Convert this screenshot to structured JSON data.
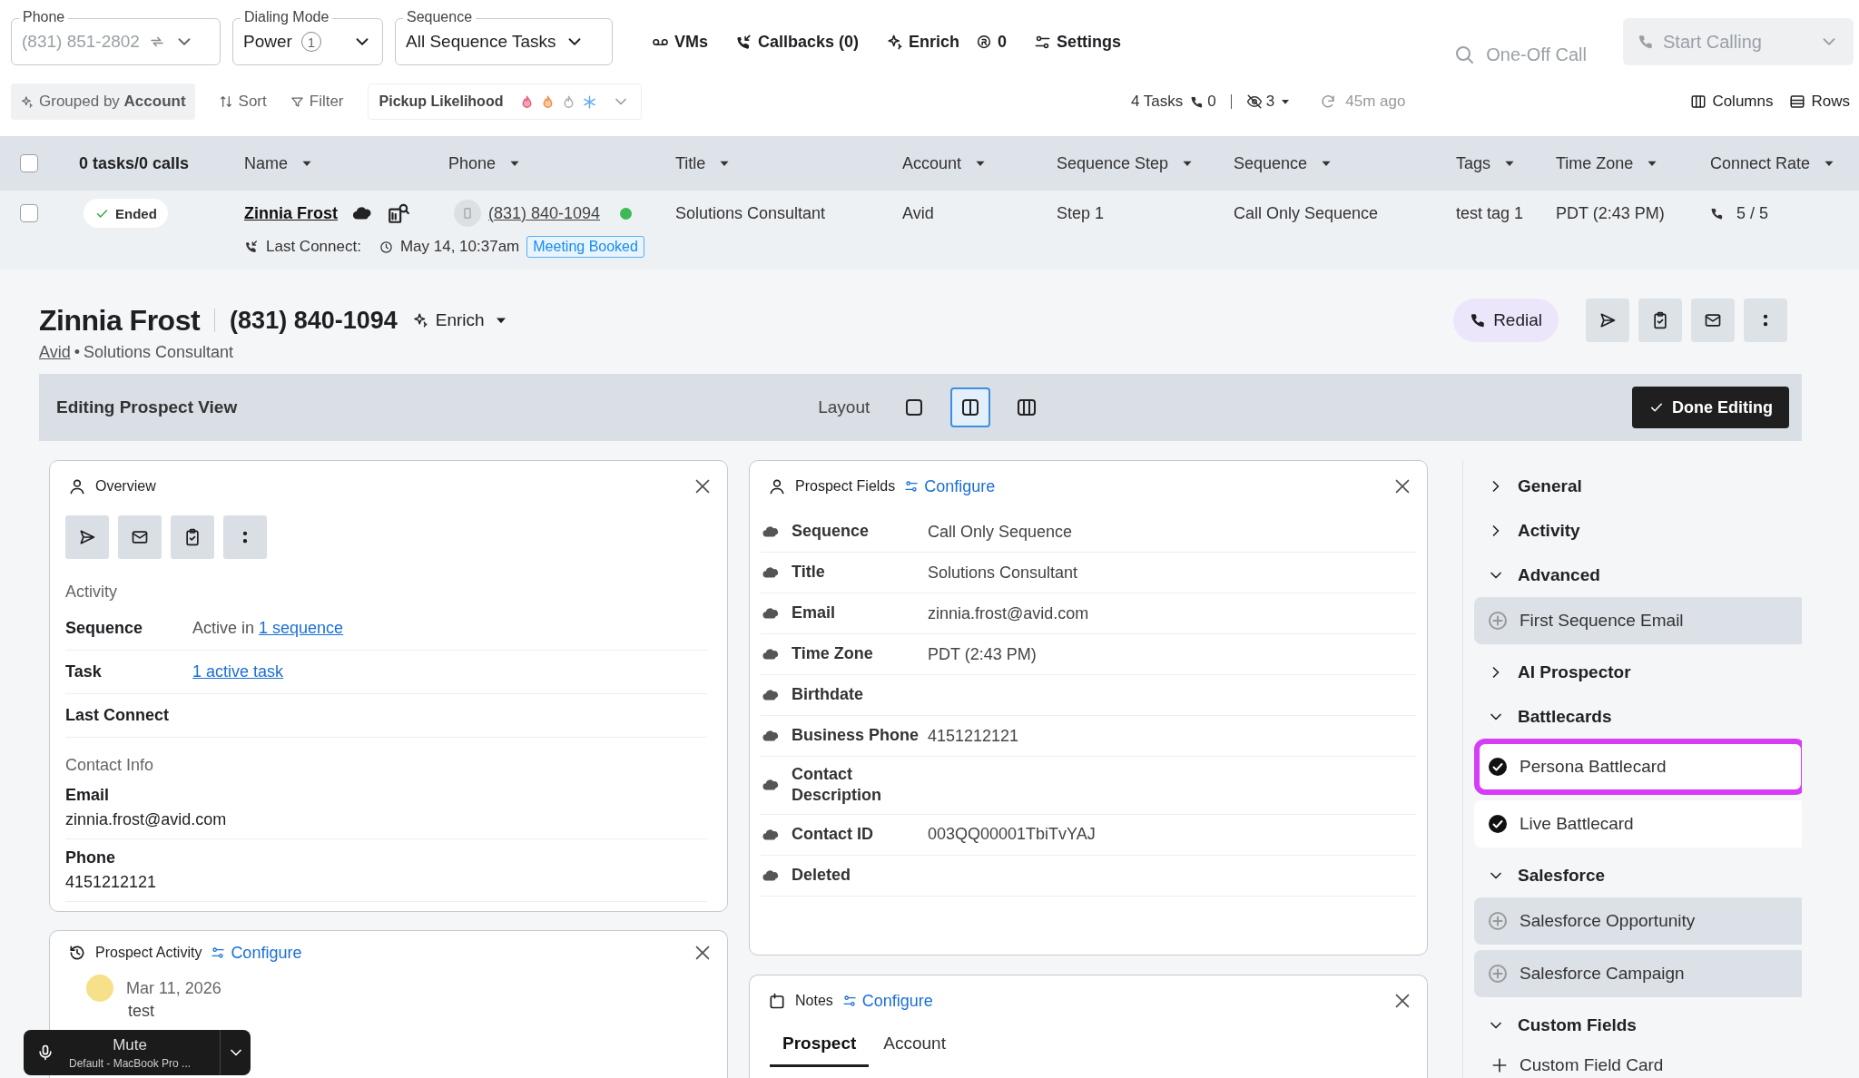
{
  "top_bar": {
    "phone": {
      "label": "Phone",
      "value": "(831) 851-2802",
      "disabled": true
    },
    "dialing_mode": {
      "label": "Dialing Mode",
      "value": "Power",
      "count": "1"
    },
    "sequence": {
      "label": "Sequence",
      "value": "All Sequence Tasks"
    },
    "actions": [
      {
        "kind": "vms",
        "label": "VMs"
      },
      {
        "kind": "callbacks",
        "label": "Callbacks (0)"
      },
      {
        "kind": "enrich",
        "label": "Enrich",
        "count": "0"
      },
      {
        "kind": "settings",
        "label": "Settings"
      }
    ],
    "one_off_call": "One-Off Call",
    "start_calling": {
      "label": "Start Calling",
      "disabled": true
    }
  },
  "toolbar": {
    "grouped_by": {
      "prefix": "Grouped by",
      "value": "Account"
    },
    "sort": "Sort",
    "filter": "Filter",
    "pickup_likelihood": "Pickup Likelihood",
    "tasks": "4 Tasks",
    "calls": "0",
    "hidden_count": "3",
    "updated": "45m ago",
    "columns": "Columns",
    "rows": "Rows"
  },
  "table": {
    "summary": "0 tasks/0 calls",
    "all_checked": false,
    "columns": [
      "Name",
      "Phone",
      "Title",
      "Account",
      "Sequence Step",
      "Sequence",
      "Tags",
      "Time Zone",
      "Connect Rate"
    ],
    "rows": [
      {
        "checked": false,
        "status": "Ended",
        "name": "Zinnia Frost",
        "phone": "(831) 840-1094",
        "online": true,
        "title": "Solutions Consultant",
        "account": "Avid",
        "sequence_step": "Step 1",
        "sequence": "Call Only Sequence",
        "tags": "test tag 1",
        "time_zone": "PDT (2:43 PM)",
        "connect_rate": "5 / 5",
        "last_connect_label": "Last Connect:",
        "last_connect": "May 14, 10:37am",
        "outcome": "Meeting Booked"
      }
    ]
  },
  "prospect": {
    "name": "Zinnia Frost",
    "phone": "(831) 840-1094",
    "enrich": "Enrich",
    "account": "Avid",
    "separator": "•",
    "title": "Solutions Consultant",
    "redial": "Redial"
  },
  "editing_bar": {
    "title": "Editing Prospect View",
    "layout_label": "Layout",
    "layouts": [
      {
        "kind": "single",
        "selected": false
      },
      {
        "kind": "double",
        "selected": true
      },
      {
        "kind": "triple",
        "selected": false
      }
    ],
    "done": "Done Editing"
  },
  "overview": {
    "title": "Overview",
    "activity_heading": "Activity",
    "activity_rows": [
      {
        "label": "Sequence",
        "text": "Active in",
        "link": "1 sequence"
      },
      {
        "label": "Task",
        "link": "1 active task"
      },
      {
        "label": "Last Connect"
      }
    ],
    "contact_heading": "Contact Info",
    "contact_rows": [
      {
        "label": "Email",
        "value": "zinnia.frost@avid.com"
      },
      {
        "label": "Phone",
        "value": "4151212121"
      }
    ]
  },
  "prospect_fields": {
    "title": "Prospect Fields",
    "configure": "Configure",
    "rows": [
      {
        "label": "Sequence",
        "value": "Call Only Sequence"
      },
      {
        "label": "Title",
        "value": "Solutions Consultant"
      },
      {
        "label": "Email",
        "value": "zinnia.frost@avid.com"
      },
      {
        "label": "Time Zone",
        "value": "PDT (2:43 PM)"
      },
      {
        "label": "Birthdate"
      },
      {
        "label": "Business Phone",
        "value": "4151212121"
      },
      {
        "label": "Contact Description"
      },
      {
        "label": "Contact ID",
        "value": "003QQ00001TbiTvYAJ"
      },
      {
        "label": "Deleted"
      }
    ]
  },
  "prospect_activity": {
    "title": "Prospect Activity",
    "configure": "Configure",
    "entries": [
      {
        "date": "Mar 11, 2026",
        "text": "test"
      }
    ]
  },
  "notes": {
    "title": "Notes",
    "configure": "Configure",
    "tabs": [
      {
        "label": "Prospect",
        "selected": true
      },
      {
        "label": "Account",
        "selected": false
      }
    ]
  },
  "sidebar": {
    "sections": [
      {
        "label": "General",
        "expanded": false
      },
      {
        "label": "Activity",
        "expanded": false
      },
      {
        "label": "Advanced",
        "expanded": true,
        "items": [
          {
            "kind": "card",
            "label": "First Sequence Email",
            "added": false,
            "highlighted": false
          }
        ]
      },
      {
        "label": "AI Prospector",
        "expanded": false
      },
      {
        "label": "Battlecards",
        "expanded": true,
        "items": [
          {
            "kind": "card",
            "label": "Persona Battlecard",
            "added": true,
            "highlighted": true
          },
          {
            "kind": "card",
            "label": "Live Battlecard",
            "added": true,
            "highlighted": false
          }
        ]
      },
      {
        "label": "Salesforce",
        "expanded": true,
        "items": [
          {
            "kind": "card",
            "label": "Salesforce Opportunity",
            "added": false,
            "highlighted": false
          },
          {
            "kind": "card",
            "label": "Salesforce Campaign",
            "added": false,
            "highlighted": false
          }
        ]
      },
      {
        "label": "Custom Fields",
        "expanded": true,
        "items": [
          {
            "kind": "add",
            "label": "Custom Field Card"
          }
        ]
      }
    ]
  },
  "mute": {
    "label": "Mute",
    "device": "Default - MacBook Pro ..."
  }
}
